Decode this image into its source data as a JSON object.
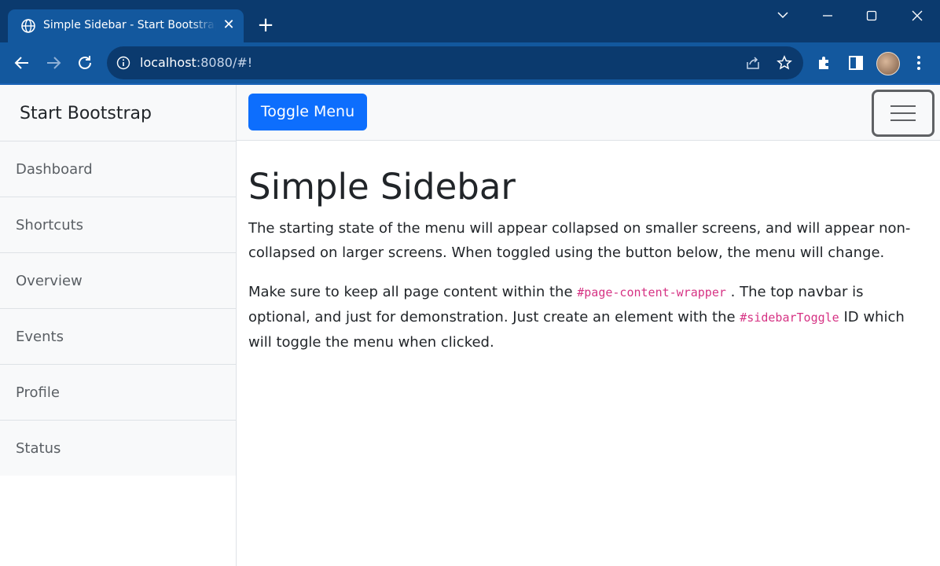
{
  "browser": {
    "tab_title": "Simple Sidebar - Start Bootstrap Template",
    "url_host": "localhost",
    "url_rest": ":8080/#!"
  },
  "sidebar": {
    "heading": "Start Bootstrap",
    "items": [
      "Dashboard",
      "Shortcuts",
      "Overview",
      "Events",
      "Profile",
      "Status"
    ]
  },
  "navbar": {
    "toggle_label": "Toggle Menu"
  },
  "content": {
    "title": "Simple Sidebar",
    "p1": "The starting state of the menu will appear collapsed on smaller screens, and will appear non-collapsed on larger screens. When toggled using the button below, the menu will change.",
    "p2_a": "Make sure to keep all page content within the ",
    "p2_code1": "#page-content-wrapper",
    "p2_b": " . The top navbar is optional, and just for demonstration. Just create an element with the ",
    "p2_code2": "#sidebarToggle",
    "p2_c": " ID which will toggle the menu when clicked."
  },
  "colors": {
    "tabbar_bg": "#0b3a6e",
    "toolbar_bg": "#13589e",
    "primary_button": "#0d6efd",
    "code_pink": "#d63384"
  }
}
